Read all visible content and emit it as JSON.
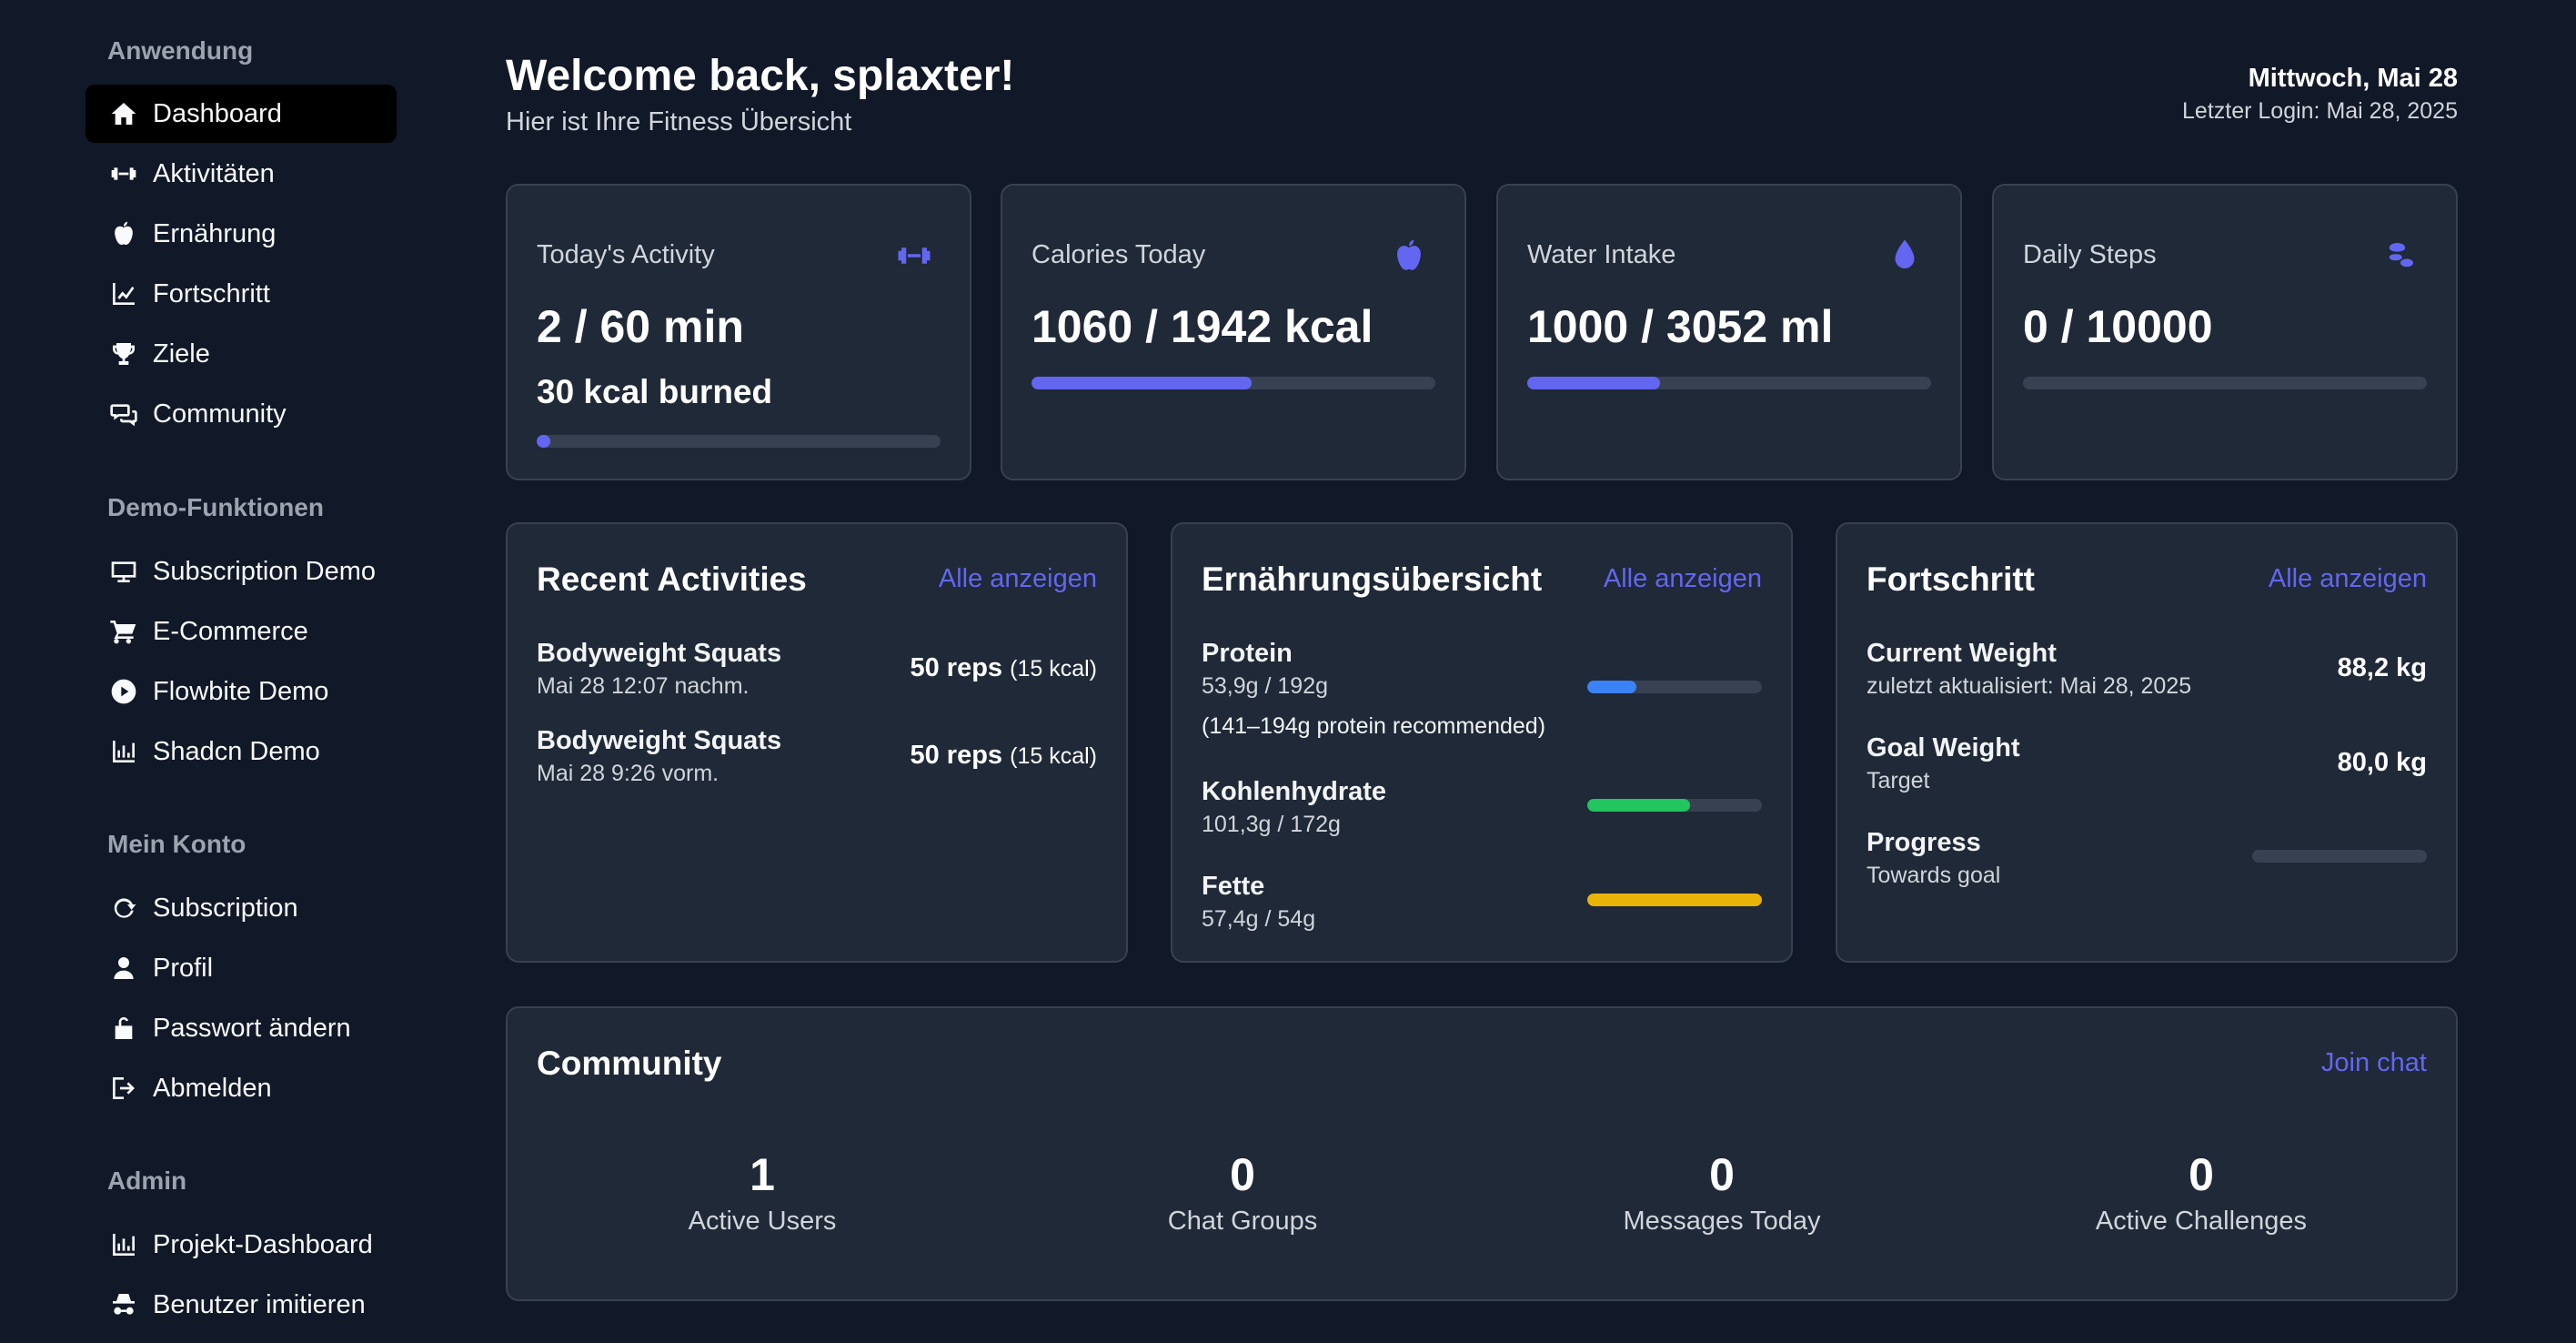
{
  "sidebar": {
    "groups": [
      {
        "title": "Anwendung",
        "items": [
          {
            "label": "Dashboard",
            "icon": "home-icon"
          },
          {
            "label": "Aktivitäten",
            "icon": "dumbbell-icon"
          },
          {
            "label": "Ernährung",
            "icon": "apple-icon"
          },
          {
            "label": "Fortschritt",
            "icon": "chart-line-icon"
          },
          {
            "label": "Ziele",
            "icon": "trophy-icon"
          },
          {
            "label": "Community",
            "icon": "chat-icon"
          }
        ]
      },
      {
        "title": "Demo-Funktionen",
        "items": [
          {
            "label": "Subscription Demo",
            "icon": "monitor-icon"
          },
          {
            "label": "E-Commerce",
            "icon": "cart-icon"
          },
          {
            "label": "Flowbite Demo",
            "icon": "play-circle-icon"
          },
          {
            "label": "Shadcn Demo",
            "icon": "bar-chart-icon"
          }
        ]
      },
      {
        "title": "Mein Konto",
        "items": [
          {
            "label": "Subscription",
            "icon": "refresh-icon"
          },
          {
            "label": "Profil",
            "icon": "user-icon"
          },
          {
            "label": "Passwort ändern",
            "icon": "unlock-icon"
          },
          {
            "label": "Abmelden",
            "icon": "logout-icon"
          }
        ]
      },
      {
        "title": "Admin",
        "items": [
          {
            "label": "Projekt-Dashboard",
            "icon": "bar-chart-icon"
          },
          {
            "label": "Benutzer imitieren",
            "icon": "incognito-icon"
          }
        ]
      }
    ],
    "active": "Dashboard"
  },
  "header": {
    "welcome": "Welcome back, splaxter!",
    "subtitle": "Hier ist Ihre Fitness Übersicht",
    "date": "Mittwoch, Mai 28",
    "last_login": "Letzter Login: Mai 28, 2025"
  },
  "stats": [
    {
      "title": "Today's Activity",
      "value": "2 / 60 min",
      "sub": "30 kcal burned",
      "progress": 0.033,
      "icon": "dumbbell-icon"
    },
    {
      "title": "Calories Today",
      "value": "1060 / 1942 kcal",
      "progress": 0.546,
      "icon": "apple-icon"
    },
    {
      "title": "Water Intake",
      "value": "1000 / 3052 ml",
      "progress": 0.328,
      "icon": "water-drop-icon"
    },
    {
      "title": "Daily Steps",
      "value": "0 / 10000",
      "progress": 0,
      "icon": "footprints-icon"
    }
  ],
  "colors": {
    "accent": "#6366f1",
    "protein": "#3b82f6",
    "carbs": "#22c55e",
    "fat": "#eab308",
    "track": "#374151"
  },
  "recent": {
    "title": "Recent Activities",
    "link": "Alle anzeigen",
    "items": [
      {
        "name": "Bodyweight Squats",
        "time": "Mai 28 12:07 nachm.",
        "reps": "50 reps",
        "kcal": "(15 kcal)"
      },
      {
        "name": "Bodyweight Squats",
        "time": "Mai 28 9:26 vorm.",
        "reps": "50 reps",
        "kcal": "(15 kcal)"
      }
    ]
  },
  "nutrition": {
    "title": "Ernährungsübersicht",
    "link": "Alle anzeigen",
    "protein": {
      "name": "Protein",
      "amount": "53,9g / 192g",
      "note": "(141–194g protein recommended)",
      "progress": 0.28
    },
    "carbs": {
      "name": "Kohlenhydrate",
      "amount": "101,3g / 172g",
      "progress": 0.59
    },
    "fat": {
      "name": "Fette",
      "amount": "57,4g / 54g",
      "progress": 1.0
    }
  },
  "progress": {
    "title": "Fortschritt",
    "link": "Alle anzeigen",
    "current": {
      "name": "Current Weight",
      "sub": "zuletzt aktualisiert: Mai 28, 2025",
      "value": "88,2 kg"
    },
    "goal": {
      "name": "Goal Weight",
      "sub": "Target",
      "value": "80,0 kg"
    },
    "towards": {
      "name": "Progress",
      "sub": "Towards goal",
      "progress": 0
    }
  },
  "community": {
    "title": "Community",
    "link": "Join chat",
    "stats": [
      {
        "value": "1",
        "label": "Active Users"
      },
      {
        "value": "0",
        "label": "Chat Groups"
      },
      {
        "value": "0",
        "label": "Messages Today"
      },
      {
        "value": "0",
        "label": "Active Challenges"
      }
    ]
  }
}
